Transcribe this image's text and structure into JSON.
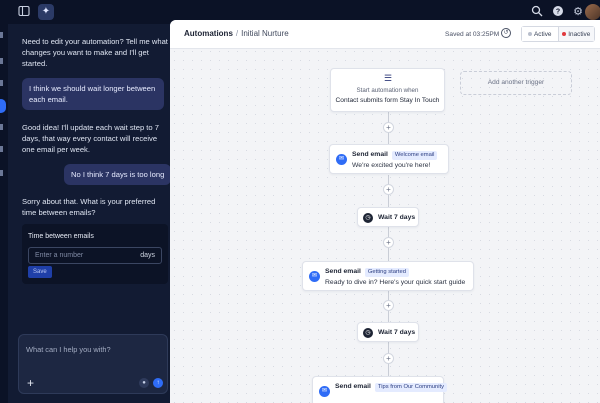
{
  "topbar": {
    "sidebar_toggle_icon": "sidebar-icon",
    "ai_icon": "sparkle-icon",
    "search_icon": "search-icon",
    "help_icon": "help-icon",
    "settings_icon": "gear-icon"
  },
  "chat": {
    "messages": [
      {
        "role": "assistant",
        "text": "Need to edit your automation? Tell me what changes you want to make and I'll get started."
      },
      {
        "role": "user",
        "text": "I think we should wait longer between each email."
      },
      {
        "role": "assistant",
        "text": "Good idea! I'll update each wait step to 7 days, that way every contact will receive one email per week."
      },
      {
        "role": "user",
        "text": "No I think 7 days is too long"
      },
      {
        "role": "assistant",
        "text": "Sorry about that. What is your preferred time between emails?"
      }
    ],
    "form": {
      "label": "Time between emails",
      "placeholder": "Enter a number",
      "unit": "days",
      "save_label": "Save"
    },
    "composer": {
      "placeholder": "What can I help you with?",
      "plus": "+",
      "mic_icon": "mic-icon",
      "send_icon": "send-icon"
    }
  },
  "header": {
    "breadcrumb_root": "Automations",
    "breadcrumb_sep": "/",
    "breadcrumb_current": "Initial Nurture",
    "saved_text": "Saved at 03:25PM",
    "active_label": "Active",
    "inactive_label": "Inactive",
    "colors": {
      "active": "#b9bfcc",
      "inactive": "#e0393e"
    }
  },
  "flow": {
    "trigger": {
      "title": "Start automation when",
      "description": "Contact submits form Stay In Touch"
    },
    "add_trigger_label": "Add another trigger",
    "steps": [
      {
        "type": "email",
        "title": "Send email",
        "tag": "Welcome email",
        "description": "We're excited you're here!"
      },
      {
        "type": "wait",
        "label": "Wait 7 days"
      },
      {
        "type": "email",
        "title": "Send email",
        "tag": "Getting started",
        "description": "Ready to dive in? Here's your quick start guide"
      },
      {
        "type": "wait",
        "label": "Wait 7 days"
      },
      {
        "type": "email",
        "title": "Send email",
        "tag": "Tips from Our Community",
        "description": ""
      }
    ],
    "accent": "#2f6cf6"
  }
}
